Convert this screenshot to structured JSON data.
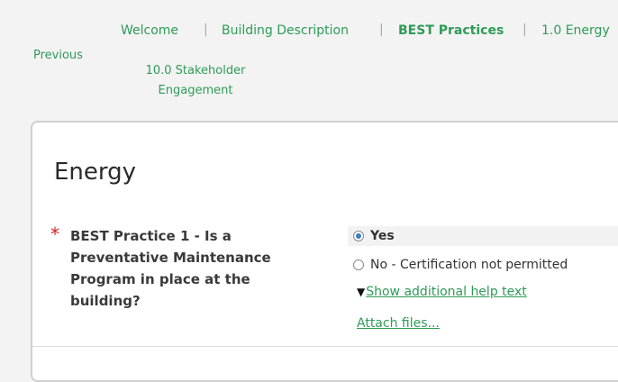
{
  "nav": {
    "items": [
      {
        "label": "Welcome",
        "active": false
      },
      {
        "label": "Building Description",
        "active": false
      },
      {
        "label": "BEST Practices",
        "active": true
      },
      {
        "label": "1.0 Energy",
        "active": false
      }
    ],
    "previous": "Previous",
    "stakeholder_line1": "10.0 Stakeholder",
    "stakeholder_line2": "Engagement"
  },
  "panel": {
    "title": "Energy",
    "required_marker": "*",
    "question_line1": "BEST Practice 1 - Is a",
    "question_line2": "Preventative Maintenance",
    "question_line3": "Program in place at the",
    "question_line4": "building?",
    "options": [
      {
        "label": "Yes",
        "checked": true
      },
      {
        "label": "No - Certification not permitted",
        "checked": false
      }
    ],
    "help_toggle": "▼",
    "help_link": "Show additional help text",
    "attach_link": "Attach files..."
  },
  "colors": {
    "link_green": "#2e9b57",
    "required_red": "#d42020",
    "radio_blue": "#3d7ec0"
  }
}
